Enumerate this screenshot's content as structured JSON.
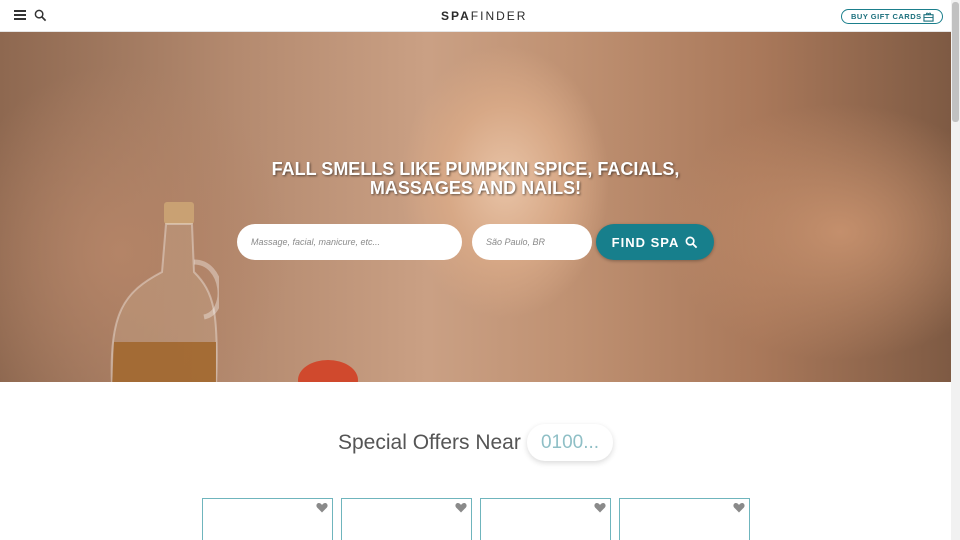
{
  "header": {
    "logo_bold": "SPA",
    "logo_thin": "FINDER",
    "gift_button_label": "BUY GIFT CARDS",
    "menu_icon": "hamburger-menu-icon",
    "search_icon": "search-icon",
    "gift_icon": "gift-icon"
  },
  "hero": {
    "title_line1": "FALL SMELLS LIKE PUMPKIN SPICE, FACIALS,",
    "title_line2": "MASSAGES AND NAILS!",
    "search_placeholder": "Massage, facial, manicure, etc...",
    "location_placeholder": "São Paulo, BR",
    "find_button_label": "FIND SPA",
    "find_icon": "search-icon"
  },
  "offers": {
    "heading": "Special Offers Near",
    "zip_value": "0100...",
    "card_count_visible": 4,
    "heart_icon": "heart-icon"
  },
  "colors": {
    "accent": "#177f8c",
    "card_border": "#6fb5bd",
    "zip_text": "#8fbfc6"
  }
}
